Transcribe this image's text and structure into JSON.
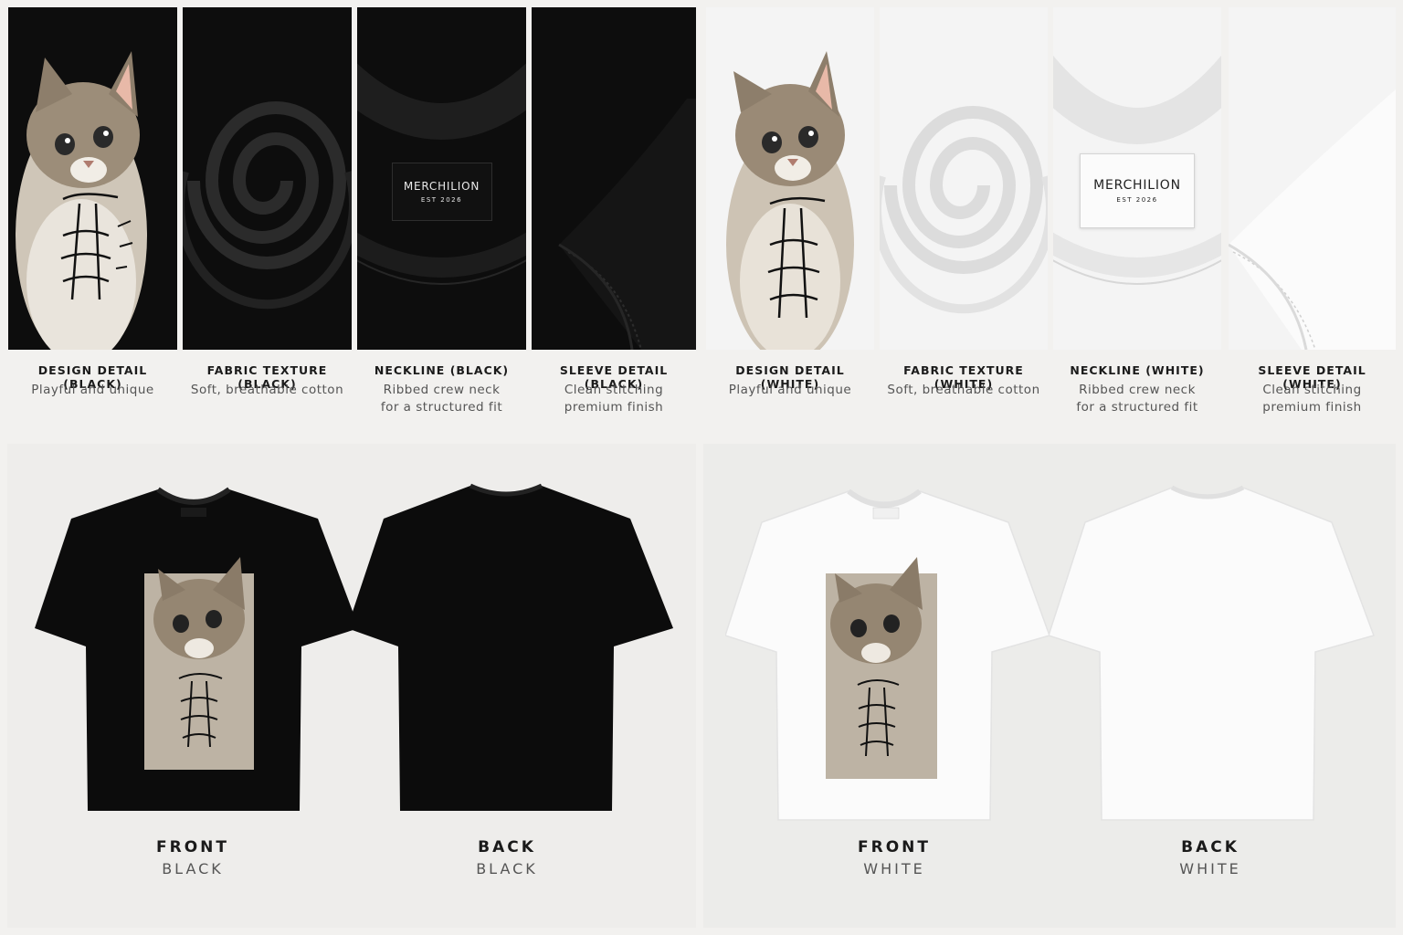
{
  "brand": {
    "name": "MERCHILION",
    "est": "EST 2026"
  },
  "details": [
    {
      "title": "DESIGN DETAIL (BLACK)",
      "subtitle": "Playful and unique",
      "variant": "dark",
      "kind": "design"
    },
    {
      "title": "FABRIC TEXTURE (BLACK)",
      "subtitle": "Soft, breathable cotton",
      "variant": "dark",
      "kind": "fabric"
    },
    {
      "title": "NECKLINE (BLACK)",
      "subtitle": "Ribbed crew neck\nfor a structured fit",
      "variant": "dark",
      "kind": "neckline"
    },
    {
      "title": "SLEEVE DETAIL (BLACK)",
      "subtitle": "Clean stitching\npremium finish",
      "variant": "dark",
      "kind": "sleeve"
    },
    {
      "title": "DESIGN DETAIL (WHITE)",
      "subtitle": "Playful and unique",
      "variant": "light",
      "kind": "design"
    },
    {
      "title": "FABRIC TEXTURE (WHITE)",
      "subtitle": "Soft, breathable cotton",
      "variant": "light",
      "kind": "fabric"
    },
    {
      "title": "NECKLINE (WHITE)",
      "subtitle": "Ribbed crew neck\nfor a structured fit",
      "variant": "light",
      "kind": "neckline"
    },
    {
      "title": "SLEEVE DETAIL (WHITE)",
      "subtitle": "Clean stitching\npremium finish",
      "variant": "light",
      "kind": "sleeve"
    }
  ],
  "views": [
    {
      "side": "FRONT",
      "color": "BLACK"
    },
    {
      "side": "BACK",
      "color": "BLACK"
    },
    {
      "side": "FRONT",
      "color": "WHITE"
    },
    {
      "side": "BACK",
      "color": "WHITE"
    }
  ],
  "colors": {
    "black_shirt": "#0c0c0c",
    "white_shirt": "#fbfbfb",
    "page_bg": "#f2f1ef"
  }
}
